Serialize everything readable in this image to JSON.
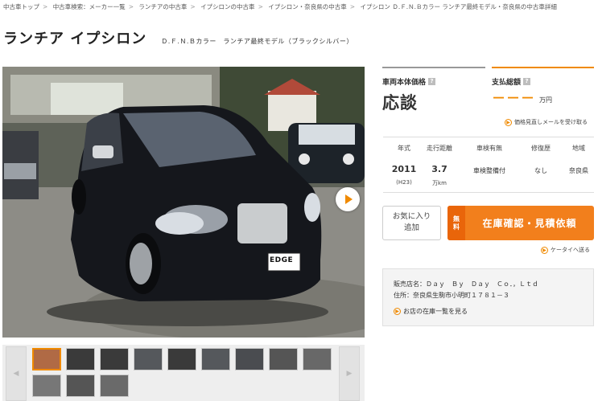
{
  "breadcrumb": [
    "中古車トップ",
    "中古車検索：メーカー一覧",
    "ランチアの中古車",
    "イプシロンの中古車",
    "イプシロン・奈良県の中古車",
    "イプシロン Ｄ.Ｆ.Ｎ.Ｂカラー ランチア最終モデル・奈良県の中古車詳細"
  ],
  "title": {
    "name": "ランチア イプシロン",
    "grade": "Ｄ.Ｆ.Ｎ.Ｂカラー　ランチア最終モデル（ブラックシルバー）"
  },
  "price": {
    "body_label": "車両本体価格",
    "body_value": "応談",
    "total_label": "支払総額",
    "total_value": "－－－",
    "total_unit": "万円",
    "help_icon": "?",
    "mail_link": "価格見直しメールを受け取る"
  },
  "specs": {
    "headers": [
      "年式",
      "走行距離",
      "車検有無",
      "修復歴",
      "地域"
    ],
    "year": "2011",
    "year_sub": "(H23)",
    "mileage": "3.7",
    "mileage_unit": "万km",
    "inspection": "車検整備付",
    "repair": "なし",
    "region": "奈良県"
  },
  "actions": {
    "favorite": "お気に入り追加",
    "free_tag": "無料",
    "quote": "在庫確認・見積依頼",
    "mobile_link": "ケータイへ送る"
  },
  "shop": {
    "name_line": "販売店名：Ｄａｙ　Ｂｙ　Ｄａｙ　Ｃｏ．，Ｌｔｄ",
    "address_line": "住所：奈良県生駒市小明町１７８１－３",
    "stock_link": "お店の在庫一覧を見る"
  },
  "photo_badge": "EDGE",
  "colors": {
    "accent": "#f08a00",
    "quote_button": "#f27f1c"
  }
}
